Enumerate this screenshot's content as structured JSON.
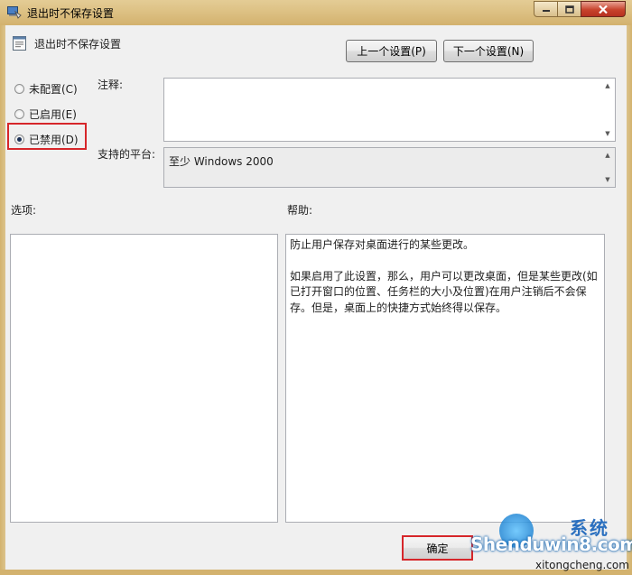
{
  "window": {
    "title": "退出时不保存设置",
    "controls": {
      "minimize": "—",
      "maximize": "□",
      "close": "✕"
    }
  },
  "header": {
    "setting_name": "退出时不保存设置",
    "prev_button": "上一个设置(P)",
    "next_button": "下一个设置(N)"
  },
  "state": {
    "options": [
      {
        "label": "未配置(C)",
        "checked": false
      },
      {
        "label": "已启用(E)",
        "checked": false
      },
      {
        "label": "已禁用(D)",
        "checked": true
      }
    ]
  },
  "comment": {
    "label": "注释:",
    "value": ""
  },
  "platform": {
    "label": "支持的平台:",
    "value": "至少 Windows 2000"
  },
  "options_pane": {
    "label": "选项:"
  },
  "help_pane": {
    "label": "帮助:",
    "paragraphs": [
      "防止用户保存对桌面进行的某些更改。",
      "如果启用了此设置，那么，用户可以更改桌面，但是某些更改(如已打开窗口的位置、任务栏的大小及位置)在用户注销后不会保存。但是，桌面上的快捷方式始终得以保存。"
    ]
  },
  "footer": {
    "ok_button": "确定"
  },
  "watermark": {
    "brand": "Shenduwin8.com",
    "cn": "系统",
    "site": "xitongcheng.com"
  },
  "colors": {
    "highlight": "#d6262a",
    "titlebar": "#d3b26e",
    "close": "#c7432c"
  }
}
